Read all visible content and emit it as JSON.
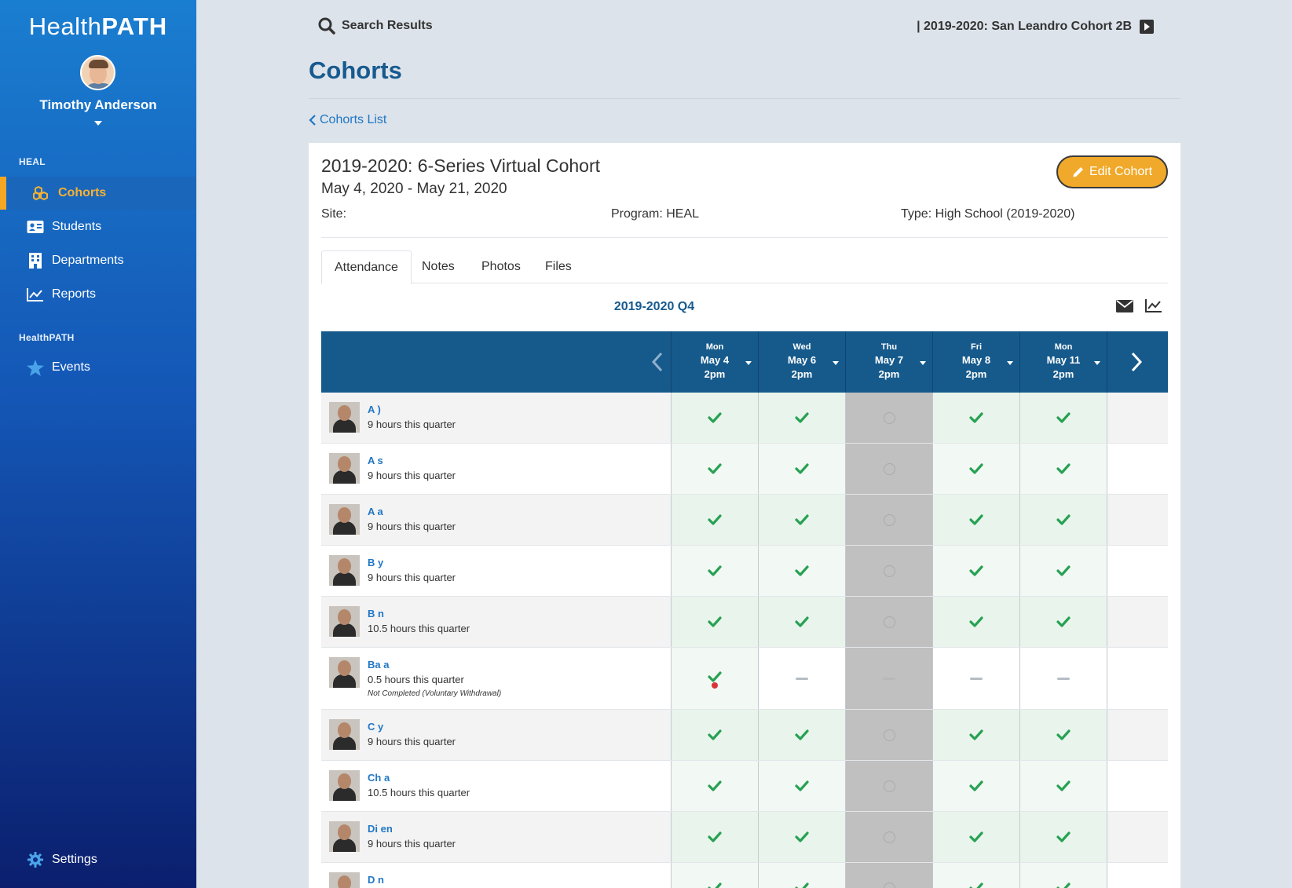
{
  "app": {
    "logo_light": "Health",
    "logo_bold": "PATH"
  },
  "user": {
    "name": "Timothy Anderson"
  },
  "sidebar": {
    "sections": [
      {
        "label": "HEAL"
      },
      {
        "label": "HealthPATH"
      }
    ],
    "items": [
      {
        "label": "Cohorts",
        "icon": "cubes-icon"
      },
      {
        "label": "Students",
        "icon": "id-card-icon"
      },
      {
        "label": "Departments",
        "icon": "building-icon"
      },
      {
        "label": "Reports",
        "icon": "line-chart-icon"
      },
      {
        "label": "Events",
        "icon": "star-icon"
      },
      {
        "label": "Settings",
        "icon": "gear-icon"
      }
    ]
  },
  "topbar": {
    "search_label": "Search Results",
    "cohort_label": "| 2019-2020: San Leandro Cohort 2B"
  },
  "page": {
    "title": "Cohorts",
    "back_link": "Cohorts List"
  },
  "cohort": {
    "name": "2019-2020: 6-Series Virtual Cohort",
    "dates": "May 4, 2020 - May 21, 2020",
    "edit_label": "Edit Cohort",
    "site": "Site:",
    "program": "Program: HEAL",
    "type": "Type: High School (2019-2020)"
  },
  "tabs": [
    {
      "label": "Attendance"
    },
    {
      "label": "Notes"
    },
    {
      "label": "Photos"
    },
    {
      "label": "Files"
    }
  ],
  "attendance": {
    "quarter": "2019-2020 Q4",
    "days": [
      {
        "dow": "Mon",
        "date": "May 4",
        "time": "2pm"
      },
      {
        "dow": "Wed",
        "date": "May 6",
        "time": "2pm"
      },
      {
        "dow": "Thu",
        "date": "May 7",
        "time": "2pm"
      },
      {
        "dow": "Fri",
        "date": "May 8",
        "time": "2pm"
      },
      {
        "dow": "Mon",
        "date": "May 11",
        "time": "2pm"
      }
    ],
    "students": [
      {
        "name": "A                              )",
        "hours": "9 hours this quarter",
        "note": "",
        "marks": [
          "check",
          "check",
          "none",
          "check",
          "check"
        ]
      },
      {
        "name": "A              s",
        "hours": "9 hours this quarter",
        "note": "",
        "marks": [
          "check",
          "check",
          "none",
          "check",
          "check"
        ]
      },
      {
        "name": "A                        a",
        "hours": "9 hours this quarter",
        "note": "",
        "marks": [
          "check",
          "check",
          "none",
          "check",
          "check"
        ]
      },
      {
        "name": "B              y",
        "hours": "9 hours this quarter",
        "note": "",
        "marks": [
          "check",
          "check",
          "none",
          "check",
          "check"
        ]
      },
      {
        "name": "B                        n",
        "hours": "10.5 hours this quarter",
        "note": "",
        "marks": [
          "check",
          "check",
          "none",
          "check",
          "check"
        ]
      },
      {
        "name": "Ba                   a",
        "hours": "0.5 hours this quarter",
        "note": "Not Completed (Voluntary Withdrawal)",
        "marks": [
          "check-alert",
          "dash",
          "dash",
          "dash",
          "dash"
        ]
      },
      {
        "name": "C                         y",
        "hours": "9 hours this quarter",
        "note": "",
        "marks": [
          "check",
          "check",
          "none",
          "check",
          "check"
        ]
      },
      {
        "name": "Ch                    a",
        "hours": "10.5 hours this quarter",
        "note": "",
        "marks": [
          "check",
          "check",
          "none",
          "check",
          "check"
        ]
      },
      {
        "name": "Di              en",
        "hours": "9 hours this quarter",
        "note": "",
        "marks": [
          "check",
          "check",
          "none",
          "check",
          "check"
        ]
      },
      {
        "name": "D              n",
        "hours": "",
        "note": "",
        "marks": [
          "check",
          "check",
          "none",
          "check",
          "check"
        ]
      }
    ]
  },
  "colors": {
    "accent": "#f0a92a",
    "brand_blue": "#165a8c",
    "link": "#2077c5",
    "check": "#27a153"
  }
}
